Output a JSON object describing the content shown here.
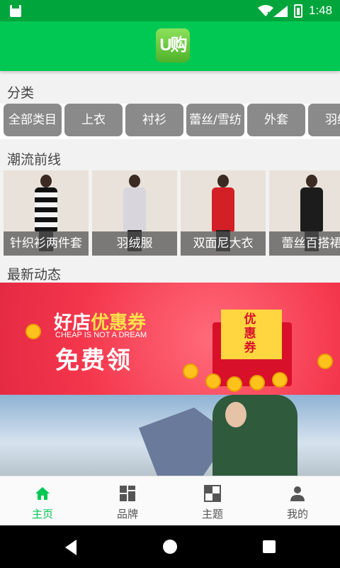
{
  "status": {
    "time": "1:48",
    "icons": [
      "sd-card-icon",
      "wifi-icon",
      "signal-icon",
      "battery-charging-icon"
    ]
  },
  "header": {
    "logo_text": "U购"
  },
  "sections": {
    "category": "分类",
    "trend": "潮流前线",
    "news": "最新动态"
  },
  "categories": [
    "全部类目",
    "上衣",
    "衬衫",
    "蕾丝/雪纺",
    "外套",
    "羽绒"
  ],
  "trends": [
    {
      "label": "针织衫两件套",
      "color": "#f4f4f4"
    },
    {
      "label": "羽绒服",
      "color": "#d8d6dc"
    },
    {
      "label": "双面尼大衣",
      "color": "#d31f26"
    },
    {
      "label": "蕾丝百搭裙",
      "color": "#1c1c1c"
    }
  ],
  "banner": {
    "line1_a": "好店",
    "line1_b": "优惠券",
    "line2": "CHEAP IS NOT A DREAM",
    "line3": "免费领",
    "card_text": "优惠券"
  },
  "bottom_nav": [
    {
      "label": "主页",
      "icon": "home-icon",
      "active": true
    },
    {
      "label": "品牌",
      "icon": "brand-grid-icon",
      "active": false
    },
    {
      "label": "主题",
      "icon": "theme-icon",
      "active": false
    },
    {
      "label": "我的",
      "icon": "person-icon",
      "active": false
    }
  ],
  "colors": {
    "accent": "#00c853",
    "status_bar": "#00a53b",
    "chip": "#8a8a8a",
    "banner": "#f4364c"
  },
  "system_nav": [
    "back-icon",
    "home-circle-icon",
    "recents-icon"
  ]
}
